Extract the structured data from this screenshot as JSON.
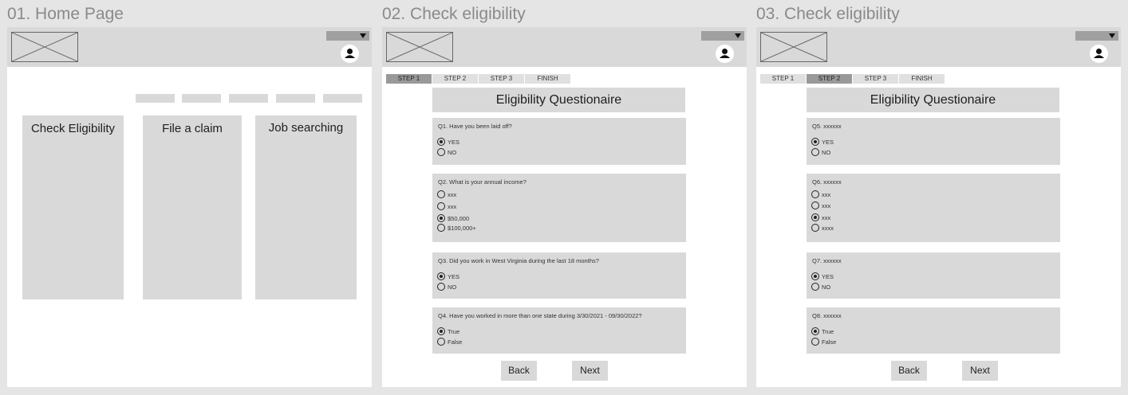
{
  "home": {
    "title": "01. Home Page",
    "cards": [
      "Check Eligibility",
      "File a claim",
      "Job searching"
    ]
  },
  "check1": {
    "title": "02. Check eligibility",
    "steps": [
      "STEP 1",
      "STEP 2",
      "STEP 3",
      "FINISH"
    ],
    "active_step": 0,
    "form_title": "Eligibility Questionaire",
    "questions": [
      {
        "text": "Q1. Have you been laid off?",
        "options": [
          {
            "label": "YES",
            "selected": true
          },
          {
            "label": "NO",
            "selected": false
          }
        ]
      },
      {
        "text": "Q2. What is your annual income?",
        "options": [
          {
            "label": "xxx",
            "selected": false
          },
          {
            "label": "xxx",
            "selected": false
          },
          {
            "label": "$50,000",
            "selected": true
          },
          {
            "label": "$100,000+",
            "selected": false
          }
        ]
      },
      {
        "text": "Q3. Did you work in West Virginia during the last 18 months?",
        "options": [
          {
            "label": "YES",
            "selected": true
          },
          {
            "label": "NO",
            "selected": false
          }
        ]
      },
      {
        "text": "Q4. Have you worked in more than one state during 3/30/2021 - 09/30/2022?",
        "options": [
          {
            "label": "True",
            "selected": true
          },
          {
            "label": "False",
            "selected": false
          }
        ]
      }
    ],
    "back": "Back",
    "next": "Next"
  },
  "check2": {
    "title": "03. Check eligibility",
    "steps": [
      "STEP 1",
      "STEP 2",
      "STEP 3",
      "FINISH"
    ],
    "active_step": 1,
    "form_title": "Eligibility Questionaire",
    "questions": [
      {
        "text": "Q5. xxxxxx",
        "options": [
          {
            "label": "YES",
            "selected": true
          },
          {
            "label": "NO",
            "selected": false
          }
        ]
      },
      {
        "text": "Q6. xxxxxx",
        "options": [
          {
            "label": "xxx",
            "selected": false
          },
          {
            "label": "xxx",
            "selected": false
          },
          {
            "label": "xxx",
            "selected": true
          },
          {
            "label": "xxxx",
            "selected": false
          }
        ]
      },
      {
        "text": "Q7. xxxxxx",
        "options": [
          {
            "label": "YES",
            "selected": true
          },
          {
            "label": "NO",
            "selected": false
          }
        ]
      },
      {
        "text": "Q8. xxxxxx",
        "options": [
          {
            "label": "True",
            "selected": true
          },
          {
            "label": "False",
            "selected": false
          }
        ]
      }
    ],
    "back": "Back",
    "next": "Next"
  },
  "icons": {
    "logo": "image-placeholder-icon",
    "dropdown": "caret-down-icon",
    "avatar": "user-icon"
  }
}
